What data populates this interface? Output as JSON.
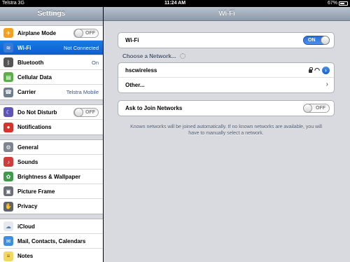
{
  "status_bar": {
    "carrier": "Telstra  3G",
    "time": "11:24 AM",
    "battery": "67%",
    "battery_level": 0.67
  },
  "sidebar": {
    "title": "Settings",
    "groups": [
      [
        {
          "label": "Airplane Mode",
          "icon": "airplane-icon",
          "toggle": "OFF"
        },
        {
          "label": "Wi-Fi",
          "icon": "wifi-icon",
          "value": "Not Connected",
          "selected": true
        },
        {
          "label": "Bluetooth",
          "icon": "bluetooth-icon",
          "value": "On"
        },
        {
          "label": "Cellular Data",
          "icon": "cellular-icon"
        },
        {
          "label": "Carrier",
          "icon": "phone-icon",
          "value": "Telstra Mobile"
        }
      ],
      [
        {
          "label": "Do Not Disturb",
          "icon": "moon-icon",
          "toggle": "OFF"
        },
        {
          "label": "Notifications",
          "icon": "notifications-icon"
        }
      ],
      [
        {
          "label": "General",
          "icon": "gear-icon"
        },
        {
          "label": "Sounds",
          "icon": "speaker-icon"
        },
        {
          "label": "Brightness & Wallpaper",
          "icon": "brightness-icon"
        },
        {
          "label": "Picture Frame",
          "icon": "picture-frame-icon"
        },
        {
          "label": "Privacy",
          "icon": "hand-icon"
        }
      ],
      [
        {
          "label": "iCloud",
          "icon": "cloud-icon"
        },
        {
          "label": "Mail, Contacts, Calendars",
          "icon": "mail-icon"
        },
        {
          "label": "Notes",
          "icon": "notes-icon"
        }
      ]
    ]
  },
  "detail": {
    "title": "Wi-Fi",
    "wifi_label": "Wi-Fi",
    "wifi_toggle": "ON",
    "choose_network": "Choose a Network...",
    "networks": [
      {
        "name": "hscwireless",
        "secured": true
      },
      {
        "name": "Other...",
        "chevron": true
      }
    ],
    "ask_to_join_label": "Ask to Join Networks",
    "ask_to_join_toggle": "OFF",
    "footnote": "Known networks will be joined automatically. If no known networks are available, you will have to manually select a network."
  },
  "colors": {
    "accent": "#1a7ae6",
    "nav_bar": "#8d9aab",
    "background": "#d8dadf"
  }
}
